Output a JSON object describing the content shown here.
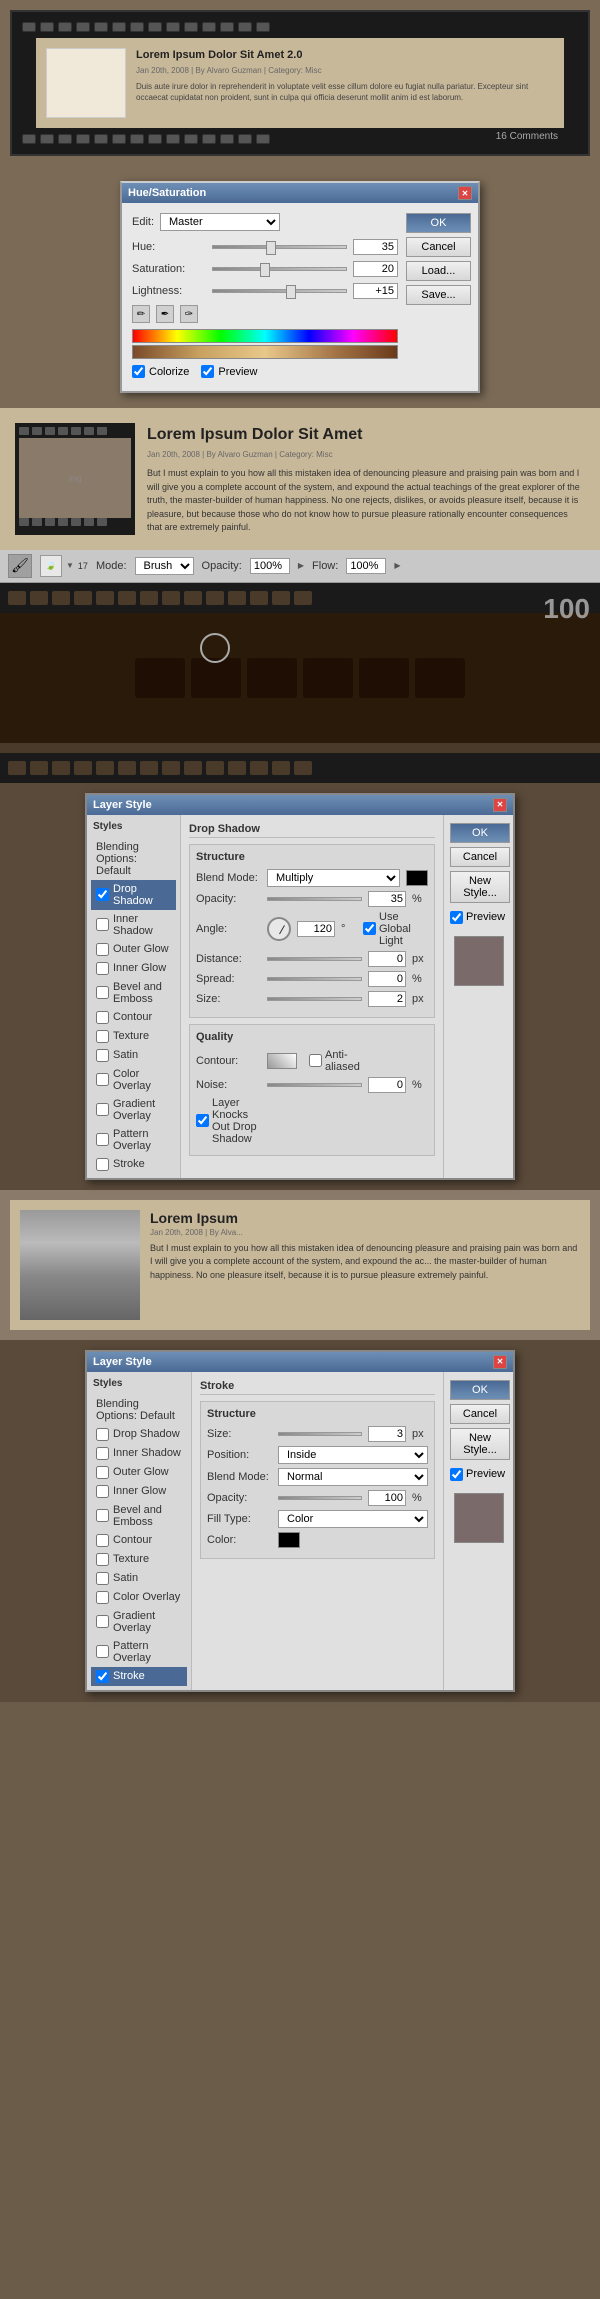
{
  "app": {
    "title": "Layer Style"
  },
  "section1": {
    "film": {
      "title": "Lorem Ipsum Dolor Sit Amet 2.0",
      "meta": "Jan 20th, 2008 | By Alvaro Guzman | Category: Misc",
      "body": "Duis aute irure dolor in reprehenderit in voluptate velit esse cillum dolore eu fugiat nulla pariatur. Excepteur sint occaecat cupidatat non proident, sunt in culpa qui officia deserunt mollit anim id est laborum.",
      "counter": "16 Comments"
    }
  },
  "hue_saturation": {
    "title": "Hue/Saturation",
    "edit_label": "Edit:",
    "edit_value": "Master",
    "hue_label": "Hue:",
    "hue_value": "35",
    "saturation_label": "Saturation:",
    "saturation_value": "20",
    "lightness_label": "Lightness:",
    "lightness_value": "+15",
    "colorize_label": "Colorize",
    "preview_label": "Preview",
    "ok_label": "OK",
    "cancel_label": "Cancel",
    "load_label": "Load...",
    "save_label": "Save..."
  },
  "section3": {
    "blog": {
      "title": "Lorem Ipsum Dolor Sit Amet",
      "meta": "Jan 20th, 2008 | By Alvaro Guzman | Category: Misc",
      "body": "But I must explain to you how all this mistaken idea of denouncing pleasure and praising pain was born and I will give you a complete account of the system, and expound the actual teachings of the great explorer of the truth, the master-builder of human happiness. No one rejects, dislikes, or avoids pleasure itself, because it is pleasure, but because those who do not know how to pursue pleasure rationally encounter consequences that are extremely painful."
    }
  },
  "brush_toolbar": {
    "mode_label": "Mode:",
    "mode_value": "Brush",
    "opacity_label": "Opacity:",
    "opacity_value": "100%",
    "flow_label": "Flow:",
    "flow_value": "100%",
    "brush_size": "17",
    "counter": "100"
  },
  "layer_style_1": {
    "title": "Layer Style",
    "sidebar_title": "Styles",
    "blending_options": "Blending Options: Default",
    "items": [
      {
        "label": "Drop Shadow",
        "checked": true,
        "active": true
      },
      {
        "label": "Inner Shadow",
        "checked": false,
        "active": false
      },
      {
        "label": "Outer Glow",
        "checked": false,
        "active": false
      },
      {
        "label": "Inner Glow",
        "checked": false,
        "active": false
      },
      {
        "label": "Bevel and Emboss",
        "checked": false,
        "active": false
      },
      {
        "label": "Contour",
        "checked": false,
        "active": false
      },
      {
        "label": "Texture",
        "checked": false,
        "active": false
      },
      {
        "label": "Satin",
        "checked": false,
        "active": false
      },
      {
        "label": "Color Overlay",
        "checked": false,
        "active": false
      },
      {
        "label": "Gradient Overlay",
        "checked": false,
        "active": false
      },
      {
        "label": "Pattern Overlay",
        "checked": false,
        "active": false
      },
      {
        "label": "Stroke",
        "checked": false,
        "active": false
      }
    ],
    "section_title": "Drop Shadow",
    "structure_title": "Structure",
    "blend_mode_label": "Blend Mode:",
    "blend_mode_value": "Multiply",
    "opacity_label": "Opacity:",
    "opacity_value": "35",
    "angle_label": "Angle:",
    "angle_value": "120",
    "use_global_light": "Use Global Light",
    "distance_label": "Distance:",
    "distance_value": "0",
    "spread_label": "Spread:",
    "spread_value": "0",
    "size_label": "Size:",
    "size_value": "2",
    "quality_title": "Quality",
    "contour_label": "Contour:",
    "anti_aliased": "Anti-aliased",
    "noise_label": "Noise:",
    "noise_value": "0",
    "layer_knocks": "Layer Knocks Out Drop Shadow",
    "ok_label": "OK",
    "cancel_label": "Cancel",
    "new_style_label": "New Style...",
    "preview_label": "Preview"
  },
  "section6": {
    "blog": {
      "title": "Lorem Ipsum",
      "meta": "Jan 20th, 2008 | By Alva...",
      "body": "But I must explain to you how all this mistaken idea of denouncing pleasure and praising pain was born and I will give you a complete account of the system, and expound the ac... the master-builder of human happiness. No one pleasure itself, because it is to pursue pleasure extremely painful."
    }
  },
  "layer_style_2": {
    "title": "Layer Style",
    "sidebar_title": "Styles",
    "blending_options": "Blending Options: Default",
    "items": [
      {
        "label": "Drop Shadow",
        "checked": false,
        "active": false
      },
      {
        "label": "Inner Shadow",
        "checked": false,
        "active": false
      },
      {
        "label": "Outer Glow",
        "checked": false,
        "active": false
      },
      {
        "label": "Inner Glow",
        "checked": false,
        "active": false
      },
      {
        "label": "Bevel and Emboss",
        "checked": false,
        "active": false
      },
      {
        "label": "Contour",
        "checked": false,
        "active": false
      },
      {
        "label": "Texture",
        "checked": false,
        "active": false
      },
      {
        "label": "Satin",
        "checked": false,
        "active": false
      },
      {
        "label": "Color Overlay",
        "checked": false,
        "active": false
      },
      {
        "label": "Gradient Overlay",
        "checked": false,
        "active": false
      },
      {
        "label": "Pattern Overlay",
        "checked": false,
        "active": false
      },
      {
        "label": "Stroke",
        "checked": true,
        "active": true
      }
    ],
    "section_title": "Stroke",
    "structure_title": "Structure",
    "size_label": "Size:",
    "size_value": "3",
    "position_label": "Position:",
    "position_value": "Inside",
    "blend_mode_label": "Blend Mode:",
    "blend_mode_value": "Normal",
    "opacity_label": "Opacity:",
    "opacity_value": "100",
    "fill_type_label": "Fill Type:",
    "fill_type_value": "Color",
    "color_label": "Color:",
    "ok_label": "OK",
    "cancel_label": "Cancel",
    "new_style_label": "New Style...",
    "preview_label": "Preview"
  }
}
